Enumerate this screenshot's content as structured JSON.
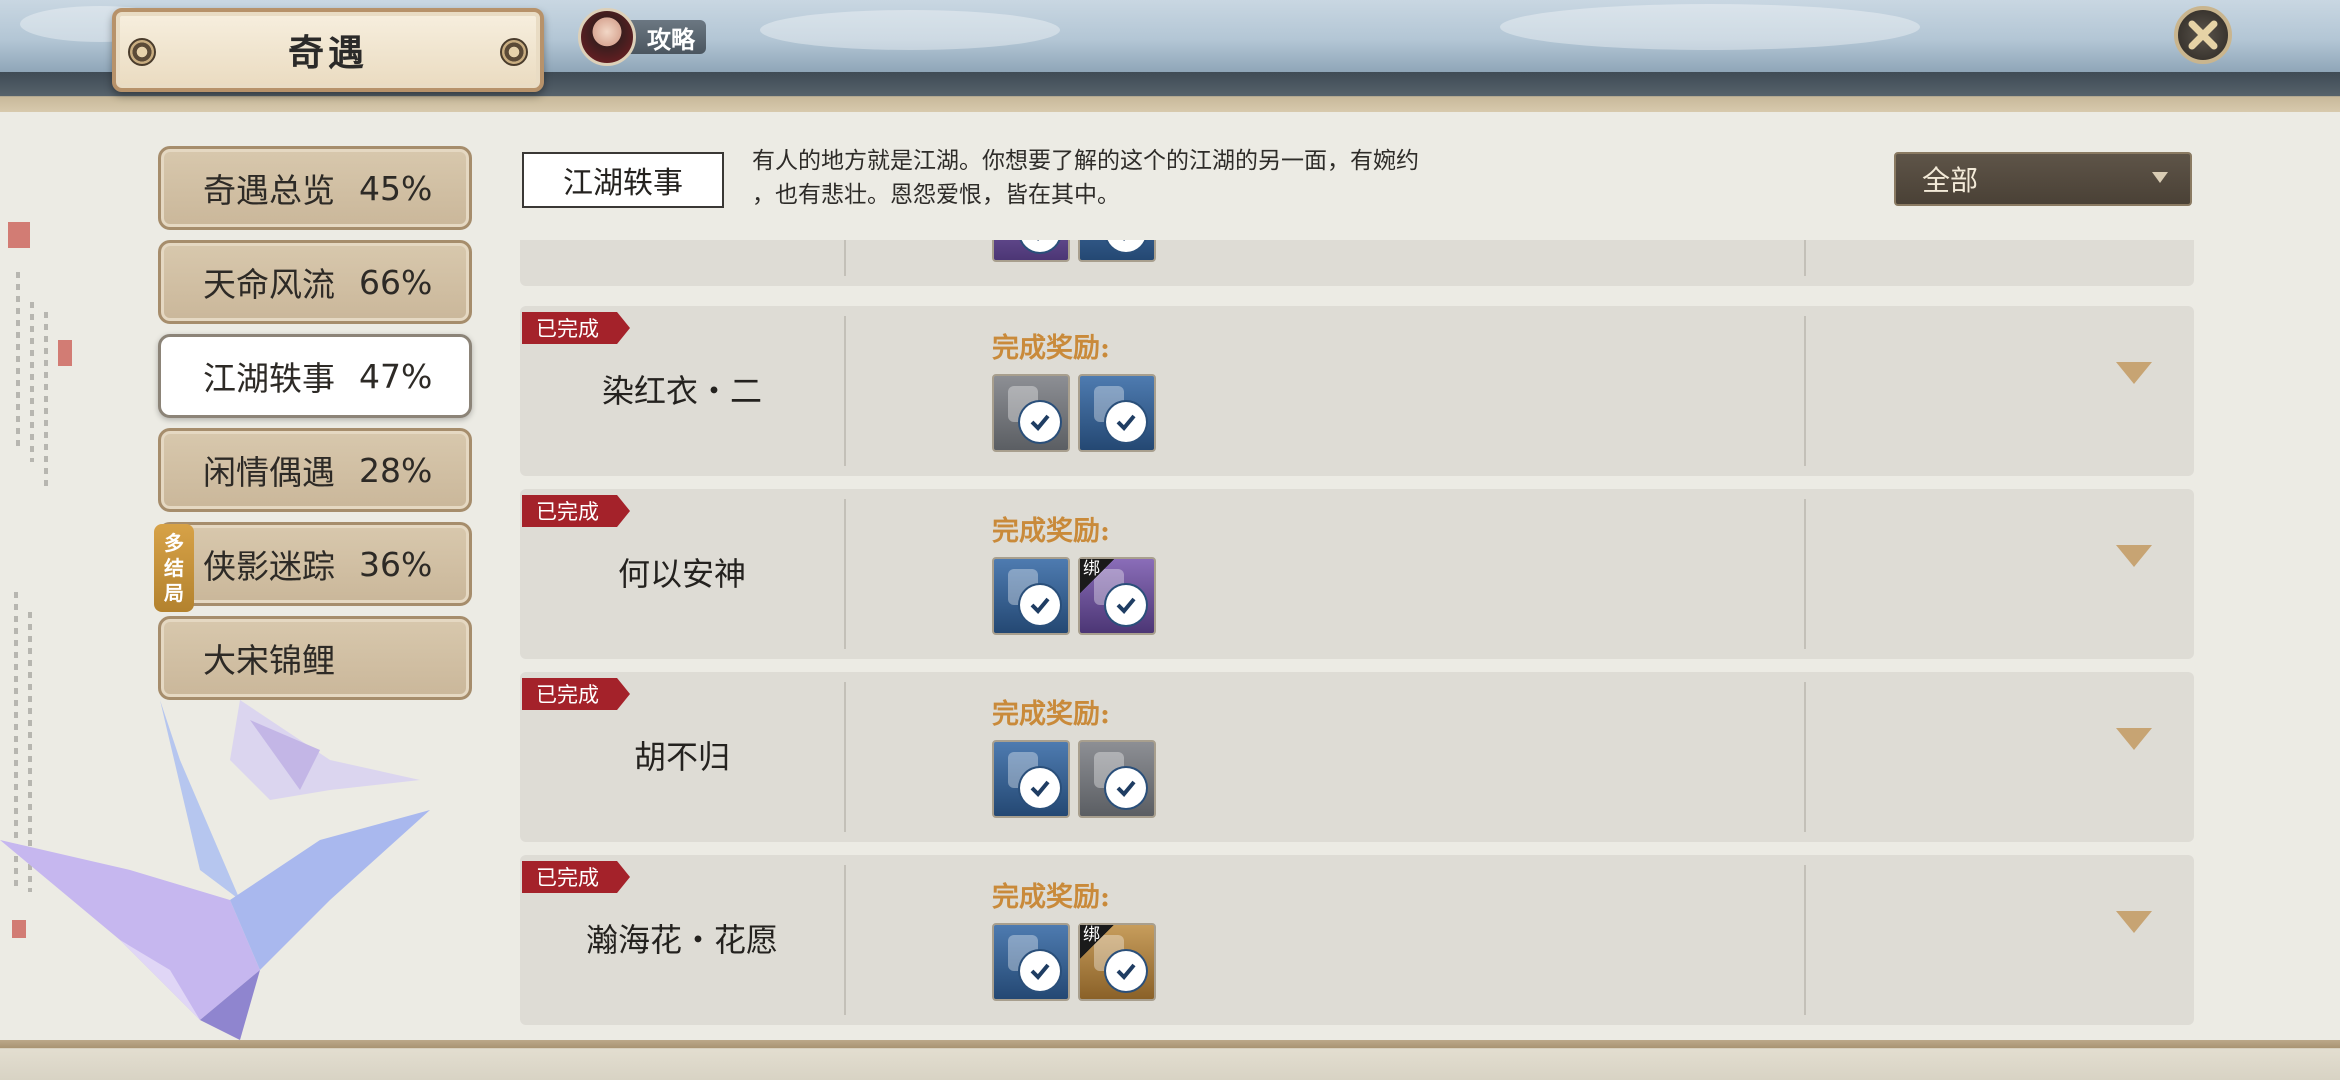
{
  "header": {
    "title": "奇遇",
    "guide_label": "攻略"
  },
  "sidebar": {
    "multi_ending_badge": [
      "多",
      "结",
      "局"
    ],
    "items": [
      {
        "label": "奇遇总览",
        "percent": "45%"
      },
      {
        "label": "天命风流",
        "percent": "66%"
      },
      {
        "label": "江湖轶事",
        "percent": "47%"
      },
      {
        "label": "闲情偶遇",
        "percent": "28%"
      },
      {
        "label": "侠影迷踪",
        "percent": "36%"
      },
      {
        "label": "大宋锦鲤",
        "percent": ""
      }
    ]
  },
  "main": {
    "category_tag": "江湖轶事",
    "description_line1": "有人的地方就是江湖。你想要了解的这个的江湖的另一面，有婉约",
    "description_line2": "，也有悲壮。恩怨爱恨，皆在其中。",
    "filter_value": "全部",
    "rows": [
      {
        "status": "已完成",
        "name": "染红衣・二",
        "reward_label": "完成奖励:"
      },
      {
        "status": "已完成",
        "name": "何以安神",
        "reward_label": "完成奖励:"
      },
      {
        "status": "已完成",
        "name": "胡不归",
        "reward_label": "完成奖励:"
      },
      {
        "status": "已完成",
        "name": "瀚海花・花愿",
        "reward_label": "完成奖励:"
      }
    ],
    "bound_mark": "绑"
  },
  "colors": {
    "done_tag": "#a4222a",
    "reward_label": "#c98a3a",
    "active_tab": "#ffffff"
  },
  "icons": [
    "close-icon",
    "check-icon",
    "chevron-down-icon",
    "paper-crane-decoration"
  ]
}
